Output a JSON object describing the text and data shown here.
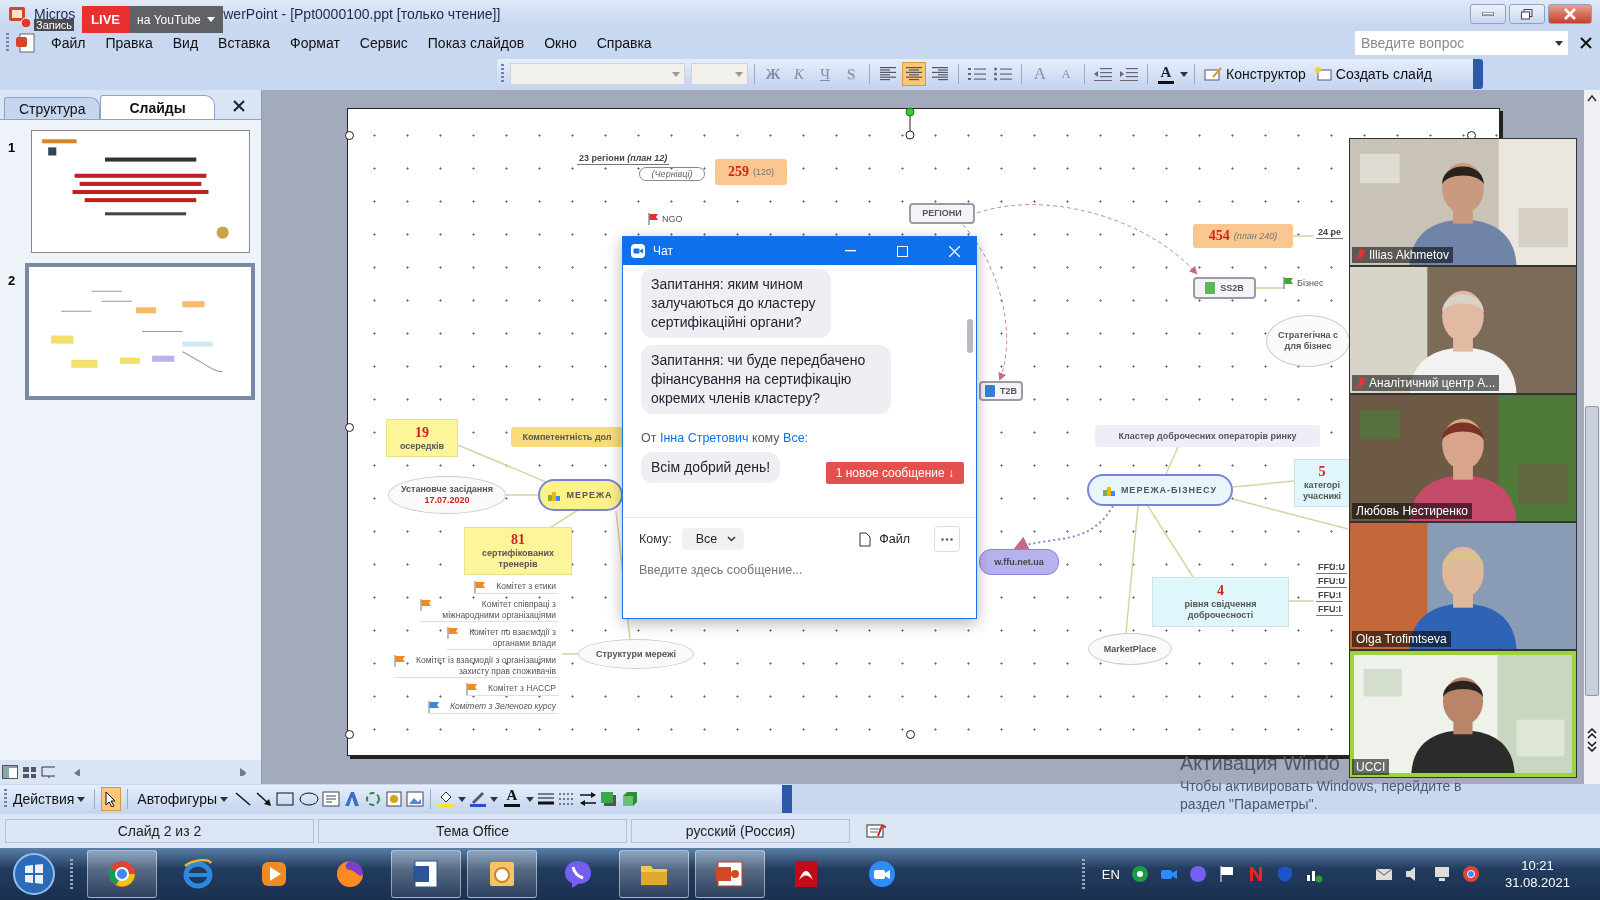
{
  "title_bar": {
    "title_start": "Micros",
    "title_end": "werPoint - [Ppt0000100.ppt [только чтение]]"
  },
  "recording": {
    "label": "Запись",
    "live": "LIVE",
    "target": "на YouTube"
  },
  "menu": [
    "Файл",
    "Правка",
    "Вид",
    "Вставка",
    "Формат",
    "Сервис",
    "Показ слайдов",
    "Окно",
    "Справка"
  ],
  "help_search": {
    "placeholder": "Введите вопрос"
  },
  "format_toolbar": {
    "text_styles": [
      "Ж",
      "К",
      "Ч",
      "S"
    ],
    "alignments": [
      {
        "selected": false
      },
      {
        "selected": true
      },
      {
        "selected": false
      }
    ],
    "grow_font": "A",
    "shrink_font": "A",
    "font_color": "A",
    "designer": "Конструктор",
    "new_slide": "Создать слайд"
  },
  "side_pane": {
    "tabs": [
      {
        "label": "Структура",
        "selected": false
      },
      {
        "label": "Слайды",
        "selected": true
      }
    ],
    "thumbnails": [
      {
        "number": "1",
        "selected": false
      },
      {
        "number": "2",
        "selected": true
      }
    ]
  },
  "slide": {
    "nodes": [
      {
        "kind": "label",
        "text": "23 регіони *(план 12)*"
      },
      {
        "kind": "pill",
        "text": "(Чернівці)"
      },
      {
        "kind": "callout",
        "number": "259",
        "text": "(120)"
      },
      {
        "kind": "flag",
        "text": "NGO",
        "color": "#e03030"
      },
      {
        "kind": "box",
        "text": "РЕГІОНИ"
      },
      {
        "kind": "callout",
        "number": "454",
        "text": "*(план 240)*"
      },
      {
        "kind": "label",
        "text": "24 ре"
      },
      {
        "kind": "box-icon",
        "text": "SS2B",
        "color": "#5cb85c"
      },
      {
        "kind": "flag",
        "text": "Бізнес",
        "color": "#3aa83a"
      },
      {
        "kind": "ellipse",
        "text": "Стратегічна с\nдля бізнес"
      },
      {
        "kind": "box-icon",
        "text": "T2B",
        "color": "#3a7fd0"
      },
      {
        "kind": "note",
        "number": "19",
        "text": "осередків",
        "color": "#fdf59a"
      },
      {
        "kind": "topic",
        "text": "Компетентність дол",
        "color": "#f8dc7a"
      },
      {
        "kind": "ellipse",
        "text": "Установче засідання",
        "date": "17.07.2020"
      },
      {
        "kind": "hub",
        "text": "МЕРЕЖА",
        "color": "#fbf28a"
      },
      {
        "kind": "note",
        "number": "81",
        "text": "сертифікованих\nтренерів",
        "color": "#fdf59a"
      },
      {
        "kind": "ellipse",
        "text": "Структури мережі"
      },
      {
        "kind": "topic",
        "text": "Кластер доброчесних операторів ринку",
        "color": "#eeeef8"
      },
      {
        "kind": "hub",
        "text": "МЕРЕЖА-БІЗНЕСУ",
        "color": "#e6f6fb"
      },
      {
        "kind": "note",
        "number": "5",
        "text": "категорі\nучасникі",
        "color": "#dff6fa"
      },
      {
        "kind": "link",
        "text": "w.ffu.net.ua"
      },
      {
        "kind": "note",
        "number": "4",
        "text": "рівня свідчення\nдоброчесності",
        "color": "#dff6fa"
      },
      {
        "kind": "label",
        "text": "FFU:U"
      },
      {
        "kind": "label",
        "text": "FFU:U"
      },
      {
        "kind": "label",
        "text": "FFU:I"
      },
      {
        "kind": "label",
        "text": "FFU:I"
      },
      {
        "kind": "ellipse",
        "text": "MarketPlace"
      }
    ],
    "committees": [
      {
        "text": "Комітет з етики",
        "color": "#f08a24",
        "italic": false
      },
      {
        "text": "Комітет співпраці з\nміжнародними організаціями",
        "color": "#f08a24",
        "italic": false
      },
      {
        "text": "Комітет по взаємодії з\nорганами влади",
        "color": "#f08a24",
        "italic": false
      },
      {
        "text": "Комітет із взаємодії з організаціями\nзахисту прав споживачів",
        "color": "#f08a24",
        "italic": false
      },
      {
        "text": "Комітет з HACCP",
        "color": "#f08a24",
        "italic": false
      },
      {
        "text": "Комітет з Зеленого курсу",
        "color": "#3a86d8",
        "italic": true
      }
    ]
  },
  "chat": {
    "title": "Чат",
    "messages": [
      "Запитання: яким чином залучаються до кластеру сертифікаційні органи?",
      "Запитання: чи буде передбачено фінансування на сертифікацію окремих членів кластеру?"
    ],
    "from": {
      "prefix": "От",
      "sender": "Інна Стретович",
      "connector": "кому",
      "recipient": "Все:"
    },
    "latest_message": "Всім добрий день!",
    "new_messages_badge": "1 новое сообщение ↓",
    "to_label": "Кому:",
    "recipient": "Все",
    "file_button": "Файл",
    "placeholder": "Введите здесь сообщение..."
  },
  "video_tiles": [
    {
      "name": "Illias Akhmetov",
      "muted": true,
      "speaking": false
    },
    {
      "name": "Аналітичний центр А...",
      "muted": true,
      "speaking": false
    },
    {
      "name": "Любовь Нестиренко",
      "muted": false,
      "speaking": false
    },
    {
      "name": "Olga Trofimtseva",
      "muted": false,
      "speaking": false
    },
    {
      "name": "UCCI",
      "muted": false,
      "speaking": true
    }
  ],
  "activation_notice": {
    "title": "Активация Windo",
    "text": "Чтобы активировать Windows, перейдите в раздел \"Параметры\"."
  },
  "drawing_toolbar": {
    "actions": "Действия",
    "autoshapes": "Автофигуры",
    "font_color": "A"
  },
  "status_bar": [
    "Слайд 2 из 2",
    "Тема Office",
    "русский (Россия)"
  ],
  "taskbar": {
    "apps": [
      {
        "open": true
      },
      {
        "open": false
      },
      {
        "open": false
      },
      {
        "open": false
      },
      {
        "open": true
      },
      {
        "open": true
      },
      {
        "open": false
      },
      {
        "open": true
      },
      {
        "open": true
      },
      {
        "open": false
      },
      {
        "open": false
      }
    ],
    "language": "EN",
    "time": "10:21",
    "date": "31.08.2021"
  }
}
